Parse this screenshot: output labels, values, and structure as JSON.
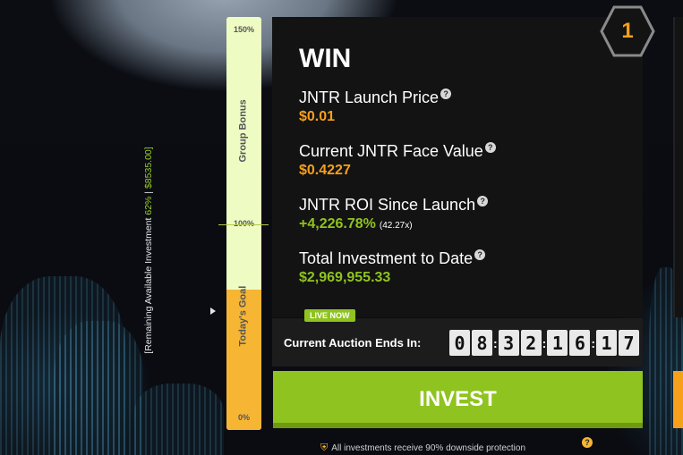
{
  "side_label": {
    "prefix": "[Remaining Available Investment",
    "percent": "62%",
    "divider": "|",
    "amount": "$8535.00]"
  },
  "progress": {
    "ticks": [
      "150%",
      "100%",
      "0%"
    ],
    "fill_percent": 34,
    "zones": {
      "upper": "Group Bonus",
      "lower": "Today's Goal"
    }
  },
  "badge": {
    "number": "1"
  },
  "panel": {
    "title": "WIN",
    "stats": [
      {
        "label": "JNTR Launch Price",
        "value": "$0.01",
        "color": "#f7a01c"
      },
      {
        "label": "Current JNTR Face Value",
        "value": "$0.4227",
        "color": "#f7a01c"
      },
      {
        "label": "JNTR ROI Since Launch",
        "value": "+4,226.78%",
        "extra": "(42.27x)",
        "color": "#8fc31f"
      },
      {
        "label": "Total Investment to Date",
        "value": "$2,969,955.33",
        "color": "#8fc31f"
      }
    ],
    "help_glyph": "?"
  },
  "auction": {
    "live_badge": "LIVE NOW",
    "label": "Current Auction Ends In:",
    "digits": [
      "0",
      "8",
      "3",
      "2",
      "1",
      "6",
      "1",
      "7"
    ],
    "separator": ":"
  },
  "invest_button": {
    "label": "INVEST"
  },
  "footer": {
    "text": "All investments receive 90% downside protection",
    "icon": "shield-icon"
  },
  "colors": {
    "accent_green": "#8fc31f",
    "accent_orange": "#f7a01c",
    "bar_bg": "#eefcc4"
  }
}
